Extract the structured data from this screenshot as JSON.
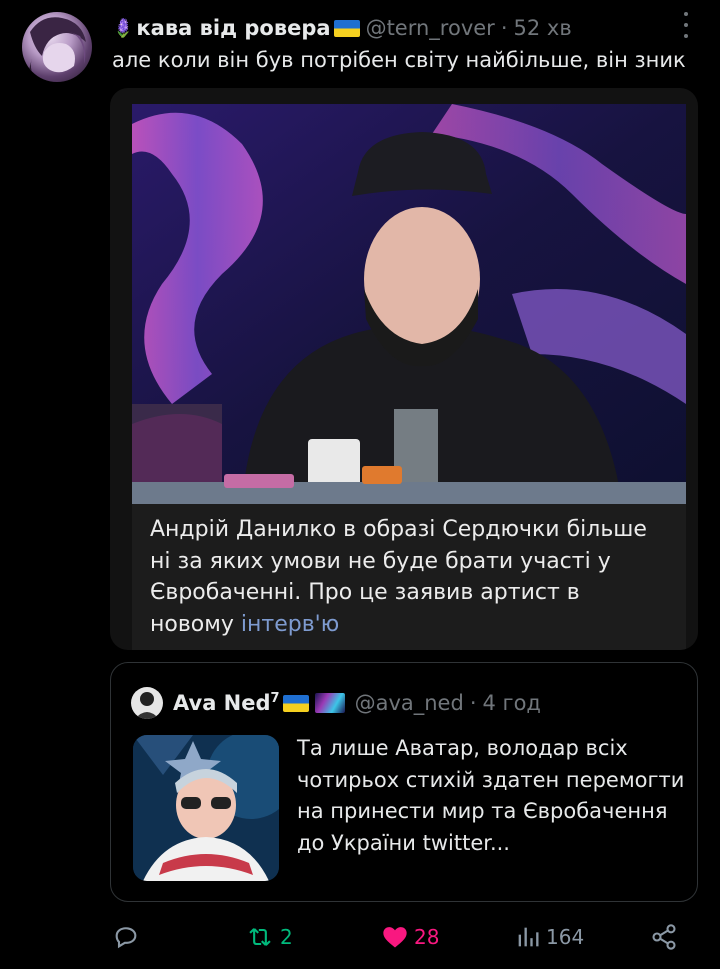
{
  "tweet": {
    "author_emoji": "🪻",
    "author_name": "кава від ровера",
    "author_handle": "@tern_rover",
    "time": "52 хв",
    "text": "але коли він був потрібен світу найбільше, він зник"
  },
  "media": {
    "caption_main": "Андрій Данилко в образі Сердючки більше ні за яких умови не буде брати участі у Євробаченні. Про це заявив артист в новому",
    "caption_link": "інтерв'ю"
  },
  "quote": {
    "name": "Ava Ned",
    "sup": "7",
    "handle": "@ava_ned",
    "time": "4 год",
    "text": "Та лише Аватар, володар всіх чотирьох стихій здатен перемогти на принести мир та Євробачення до України twitter..."
  },
  "actions": {
    "retweets": "2",
    "likes": "28",
    "views": "164"
  },
  "colors": {
    "background": "#000000",
    "muted": "#71767b",
    "retweet": "#00ba7c",
    "like": "#f91880",
    "link": "#7e9bd0"
  }
}
